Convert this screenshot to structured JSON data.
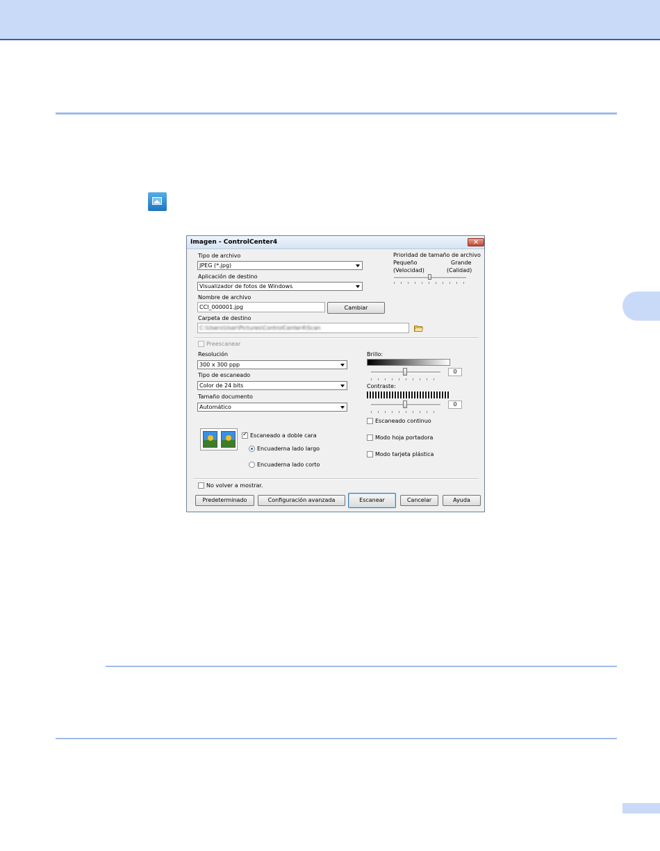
{
  "dialog": {
    "title": "Imagen - ControlCenter4",
    "close_glyph": "✕",
    "file_type": {
      "label": "Tipo de archivo",
      "value": "JPEG (*.jpg)"
    },
    "destination_app": {
      "label": "Aplicación de destino",
      "value": "Visualizador de fotos de Windows"
    },
    "file_name": {
      "label": "Nombre de archivo",
      "value": "CCI_000001.jpg",
      "button": "Cambiar"
    },
    "dest_folder": {
      "label": "Carpeta de destino",
      "value": "C:\\Users\\User\\Pictures\\ControlCenter4\\Scan"
    },
    "size_priority": {
      "label": "Prioridad de tamaño de archivo",
      "left_label": "Pequeño",
      "left_sub": "(Velocidad)",
      "right_label": "Grande",
      "right_sub": "(Calidad)",
      "level_percent": 50
    },
    "prescan": {
      "label": "Preescanear",
      "checked": false,
      "enabled": false
    },
    "resolution": {
      "label": "Resolución",
      "value": "300 x 300 ppp"
    },
    "scan_type": {
      "label": "Tipo de escaneado",
      "value": "Color de 24 bits"
    },
    "doc_size": {
      "label": "Tamaño documento",
      "value": "Automático"
    },
    "brightness": {
      "label": "Brillo:",
      "value": "0",
      "level_percent": 50
    },
    "contrast": {
      "label": "Contraste:",
      "value": "0",
      "level_percent": 50
    },
    "continuous_scan": {
      "label": "Escaneado continuo",
      "checked": false
    },
    "duplex": {
      "label": "Escaneado a doble cara",
      "checked": true,
      "option_long": "Encuaderna lado largo",
      "option_short": "Encuaderna lado corto",
      "selected": "long"
    },
    "carrier_mode": {
      "label": "Modo hoja portadora",
      "checked": false
    },
    "plastic_card_mode": {
      "label": "Modo tarjeta plástica",
      "checked": false
    },
    "dont_show_again": {
      "label": "No volver a mostrar.",
      "checked": false
    },
    "buttons": {
      "default": "Predeterminado",
      "advanced": "Configuración avanzada",
      "scan": "Escanear",
      "cancel": "Cancelar",
      "help": "Ayuda"
    }
  },
  "colors": {
    "header_band": "#c9daf8",
    "rule": "#9dbbea",
    "header_border": "#2e5fb5"
  },
  "icons": {
    "app_icon": "image-icon",
    "folder_icon": "folder-icon"
  }
}
